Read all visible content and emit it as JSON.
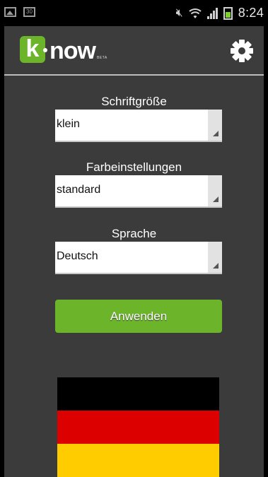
{
  "status_bar": {
    "left_icons": [
      "image-icon",
      "calendar-icon"
    ],
    "calendar_day": "30",
    "time": "8:24",
    "right_icons": [
      "mute-icon",
      "wifi-icon",
      "signal-icon",
      "battery-icon"
    ]
  },
  "header": {
    "logo_k": "k",
    "logo_text": "now",
    "logo_beta": "BETA",
    "settings_icon": "gear-icon"
  },
  "settings": {
    "font_size": {
      "label": "Schriftgröße",
      "value": "klein"
    },
    "color": {
      "label": "Farbeinstellungen",
      "value": "standard"
    },
    "language": {
      "label": "Sprache",
      "value": "Deutsch"
    },
    "apply_label": "Anwenden"
  },
  "flag": {
    "country": "Germany",
    "colors": [
      "#000000",
      "#dd0000",
      "#ffcc00"
    ]
  },
  "colors": {
    "accent": "#6cb52b",
    "background": "#3b3b3b"
  }
}
